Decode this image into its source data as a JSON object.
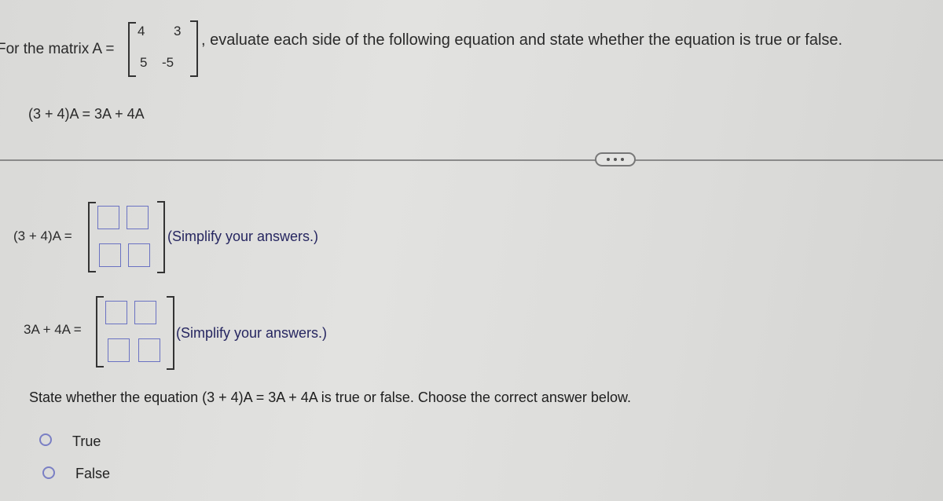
{
  "problem": {
    "intro_prefix": "For the matrix A =",
    "intro_suffix": ", evaluate each side of the following equation and state whether the equation is true or false.",
    "matrix_A": [
      [
        "4",
        "3"
      ],
      [
        "5",
        "-5"
      ]
    ],
    "equation": "(3 + 4)A = 3A + 4A"
  },
  "toolbar": {
    "more_label": "..."
  },
  "answers": [
    {
      "label": "(3 + 4)A =",
      "hint": "(Simplify your answers.)",
      "cells": [
        "",
        "",
        "",
        ""
      ]
    },
    {
      "label": "3A + 4A =",
      "hint": "(Simplify your answers.)",
      "cells": [
        "",
        "",
        "",
        ""
      ]
    }
  ],
  "question": {
    "text": "State whether the equation (3 + 4)A = 3A + 4A is true or false. Choose the correct answer below.",
    "options": [
      {
        "label": "True",
        "selected": false
      },
      {
        "label": "False",
        "selected": false
      }
    ]
  }
}
